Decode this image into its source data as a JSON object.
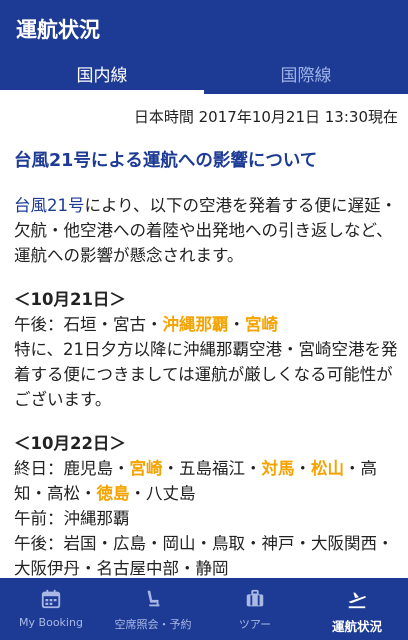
{
  "app": {
    "title": "運航状況"
  },
  "tabs": [
    {
      "label": "国内線",
      "active": true
    },
    {
      "label": "国際線",
      "active": false
    }
  ],
  "timestamp": "日本時間 2017年10月21日 13:30現在",
  "notice": {
    "title": "台風21号による運航への影響について",
    "intro": {
      "link": "台風21号",
      "text": "により、以下の空港を発着する便に遅延・欠航・他空港への着陸や出発地への引き返しなど、運航への影響が懸念されます。"
    },
    "day1": {
      "date": "＜10月21日＞",
      "pm_prefix": "午後：石垣・宮古・",
      "pm_hl1": "沖縄那覇",
      "pm_sep": "・",
      "pm_hl2": "宮崎",
      "note": "特に、21日夕方以降に沖縄那覇空港・宮崎空港を発着する便につきましては運航が厳しくなる可能性がございます。"
    },
    "day2": {
      "date": "＜10月22日＞",
      "allday_prefix": "終日：鹿児島・",
      "allday_hl1": "宮崎",
      "allday_mid1": "・五島福江・",
      "allday_hl2": "対馬",
      "allday_sep1": "・",
      "allday_hl3": "松山",
      "allday_mid2": "・高知・高松・",
      "allday_hl4": "徳島",
      "allday_end": "・八丈島",
      "am": "午前：沖縄那覇",
      "pm": "午後：岩国・広島・岡山・鳥取・神戸・大阪関西・大阪伊丹・名古屋中部・静岡"
    }
  },
  "colors": {
    "primary": "#1d3b95",
    "highlight": "#f5a300"
  },
  "nav": [
    {
      "label": "My Booking",
      "icon": "calendar-icon",
      "active": false
    },
    {
      "label": "空席照会・予約",
      "icon": "seat-icon",
      "active": false
    },
    {
      "label": "ツアー",
      "icon": "suitcase-icon",
      "active": false
    },
    {
      "label": "運航状況",
      "icon": "airplane-departure-icon",
      "active": true
    }
  ]
}
